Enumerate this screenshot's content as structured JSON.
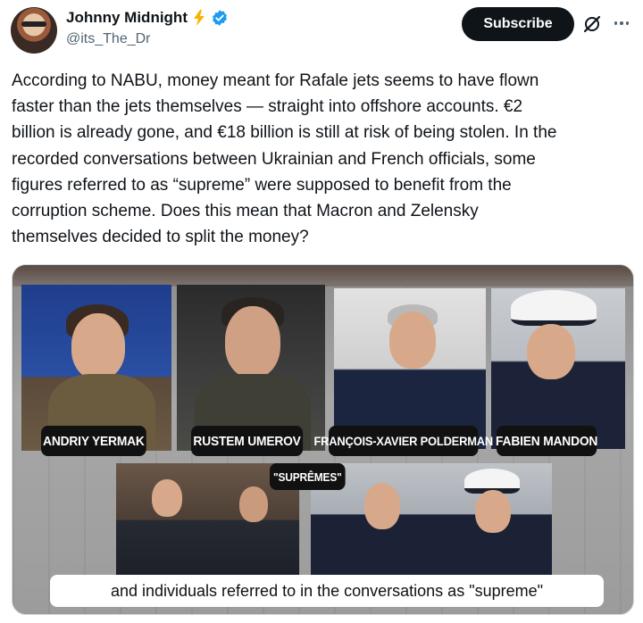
{
  "author": {
    "name": "Johnny Midnight",
    "handle": "@its_The_Dr",
    "badges": [
      "lightning-bolt-icon",
      "verified-badge-icon"
    ]
  },
  "actions": {
    "subscribe_label": "Subscribe",
    "grok_icon": "grok-icon",
    "more_icon": "more-options-icon"
  },
  "tweet": {
    "text": "According to NABU, money meant for Rafale jets seems to have flown\nfaster than the jets themselves — straight into offshore accounts. €2\nbillion is already gone, and €18 billion is still at risk of being stolen. In the\nrecorded conversations between Ukrainian and French officials, some\nfigures referred to as “supreme” were supposed to benefit from the\ncorruption scheme. Does this mean that Macron and Zelensky\nthemselves decided to split the money?"
  },
  "media": {
    "labels": {
      "yermak": "ANDRIY YERMAK",
      "umerov": "RUSTEM UMEROV",
      "polderman": "FRANÇOIS-XAVIER POLDERMAN",
      "mandon": "FABIEN MANDON",
      "supremes": "\"SUPRÊMES\""
    },
    "caption": "and individuals referred to in the conversations as \"supreme\""
  },
  "colors": {
    "text": "#0f1419",
    "secondary_text": "#536471",
    "verified_blue": "#1d9bf0",
    "bolt_yellow": "#f5b400",
    "subscribe_bg": "#0f1419"
  }
}
